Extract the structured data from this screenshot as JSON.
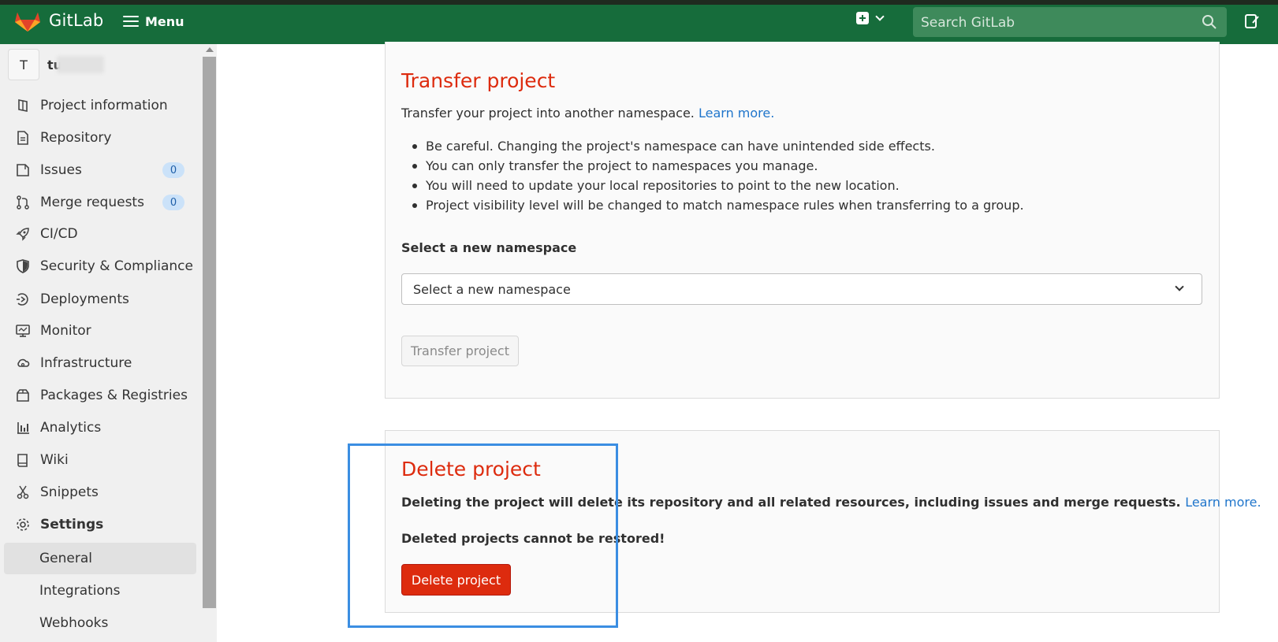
{
  "app": {
    "brand": "GitLab"
  },
  "navbar": {
    "menu_label": "Menu",
    "search_placeholder": "Search GitLab"
  },
  "sidebar": {
    "project": {
      "avatar_letter": "T",
      "name": "tu"
    },
    "items": [
      {
        "label": "Project information",
        "icon": "project-icon"
      },
      {
        "label": "Repository",
        "icon": "doc-text-icon"
      },
      {
        "label": "Issues",
        "icon": "issues-icon",
        "count": "0"
      },
      {
        "label": "Merge requests",
        "icon": "git-merge-icon",
        "count": "0"
      },
      {
        "label": "CI/CD",
        "icon": "rocket-icon"
      },
      {
        "label": "Security & Compliance",
        "icon": "shield-icon"
      },
      {
        "label": "Deployments",
        "icon": "deployments-icon"
      },
      {
        "label": "Monitor",
        "icon": "monitor-icon"
      },
      {
        "label": "Infrastructure",
        "icon": "cloud-gear-icon"
      },
      {
        "label": "Packages & Registries",
        "icon": "package-icon"
      },
      {
        "label": "Analytics",
        "icon": "chart-icon"
      },
      {
        "label": "Wiki",
        "icon": "book-icon"
      },
      {
        "label": "Snippets",
        "icon": "snippet-icon"
      },
      {
        "label": "Settings",
        "icon": "settings-icon"
      }
    ],
    "settings_sub": [
      {
        "label": "General",
        "active": true
      },
      {
        "label": "Integrations"
      },
      {
        "label": "Webhooks"
      }
    ]
  },
  "transfer": {
    "title": "Transfer project",
    "description": "Transfer your project into another namespace.",
    "learn_more": "Learn more.",
    "bullets": [
      "Be careful. Changing the project's namespace can have unintended side effects.",
      "You can only transfer the project to namespaces you manage.",
      "You will need to update your local repositories to point to the new location.",
      "Project visibility level will be changed to match namespace rules when transferring to a group."
    ],
    "namespace_label": "Select a new namespace",
    "namespace_select": "Select a new namespace",
    "button": "Transfer project"
  },
  "delete": {
    "title": "Delete project",
    "warning": "Deleting the project will delete its repository and all related resources, including issues and merge requests.",
    "learn_more": "Learn more.",
    "irreversible": "Deleted projects cannot be restored!",
    "button": "Delete project"
  },
  "colors": {
    "navbar": "#166c3b",
    "danger": "#dd2b0e",
    "link": "#1f75cb",
    "highlight": "#3b8ee2"
  }
}
